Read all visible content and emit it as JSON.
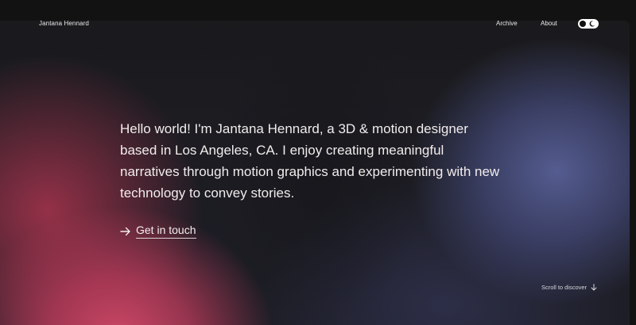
{
  "header": {
    "brand": "Jantana Hennard",
    "nav": [
      {
        "label": "Archive"
      },
      {
        "label": "About"
      }
    ],
    "theme_toggle_icon": "theme-toggle-icon"
  },
  "hero": {
    "intro": "Hello world! I'm Jantana Hennard, a 3D & motion designer based in Los Angeles, CA. I enjoy creating meaningful narratives through motion graphics and experimenting with new technology to convey stories.",
    "cta_label": "Get in touch",
    "cta_icon": "arrow-right-icon",
    "scroll_label": "Scroll to discover",
    "scroll_icon": "arrow-down-icon"
  },
  "colors": {
    "page_background": "#121212",
    "text": "#f1ecec",
    "gradient_pink": "#d64a6a",
    "gradient_blue": "#5860a0"
  }
}
